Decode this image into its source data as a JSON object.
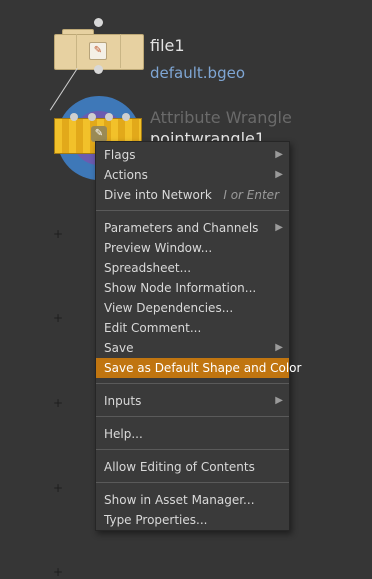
{
  "network": {
    "file_node": {
      "name": "file1",
      "file": "default.bgeo"
    },
    "wrangle_node": {
      "type_label": "Attribute Wrangle",
      "name": "pointwrangle1"
    }
  },
  "context_menu": {
    "items": [
      {
        "label": "Flags",
        "submenu": true
      },
      {
        "label": "Actions",
        "submenu": true
      },
      {
        "label": "Dive into Network",
        "shortcut": "I or Enter"
      },
      {
        "label": "Parameters and Channels",
        "submenu": true
      },
      {
        "label": "Preview Window..."
      },
      {
        "label": "Spreadsheet..."
      },
      {
        "label": "Show Node Information..."
      },
      {
        "label": "View Dependencies..."
      },
      {
        "label": "Edit Comment..."
      },
      {
        "label": "Save",
        "submenu": true
      },
      {
        "label": "Save as Default Shape and Color",
        "highlighted": true
      },
      {
        "label": "Inputs",
        "submenu": true
      },
      {
        "label": "Help..."
      },
      {
        "label": "Allow Editing of Contents"
      },
      {
        "label": "Show in Asset Manager..."
      },
      {
        "label": "Type Properties..."
      }
    ],
    "arrow_glyph": "▶",
    "highlight_color": "#c07510"
  },
  "icons": {
    "file_node_icon": "folder-icon",
    "wrangle_node_icon": "wrangle-icon",
    "grid_marker_glyph": "+"
  }
}
